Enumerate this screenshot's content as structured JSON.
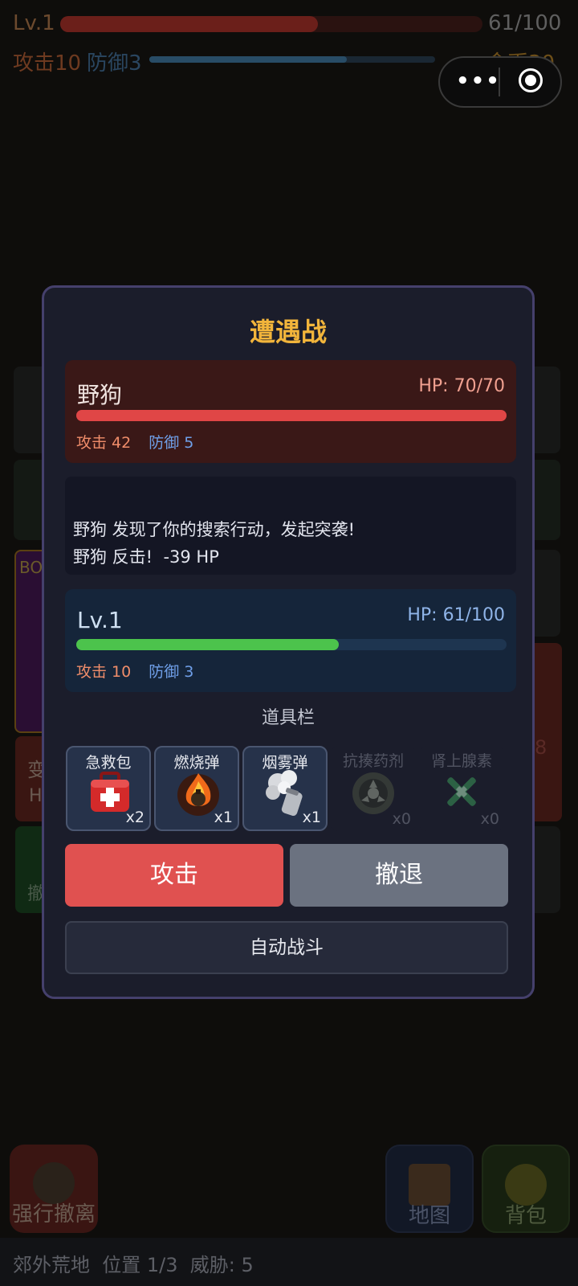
{
  "hud": {
    "level": "Lv.1",
    "hp_text": "61/100",
    "hp_fraction": 0.61,
    "attack": "攻击10",
    "defense": "防御3",
    "coins": "金币30"
  },
  "background": {
    "boss_fragment": "BO",
    "fragment_a": "变",
    "fragment_b": "H",
    "fragment_c": "撤",
    "fragment_d": "8",
    "evacuate_label": "强行撤离",
    "map_label": "地图",
    "bag_label": "背包",
    "status_bar": "郊外荒地  位置 1/3  威胁: 5"
  },
  "battle": {
    "title": "遭遇战",
    "enemy": {
      "name": "野狗",
      "hp_text": "HP: 70/70",
      "hp_fraction": 1.0,
      "attack": "攻击 42",
      "defense": "防御 5"
    },
    "log": [
      "野狗 发现了你的搜索行动，发起突袭!",
      "野狗 反击!  -39 HP"
    ],
    "player": {
      "name": "Lv.1",
      "hp_text": "HP: 61/100",
      "hp_fraction": 0.61,
      "attack": "攻击 10",
      "defense": "防御 3"
    },
    "inventory_title": "道具栏",
    "items": [
      {
        "name": "急救包",
        "count": "x2",
        "icon": "first-aid-kit-icon",
        "enabled": true
      },
      {
        "name": "燃烧弹",
        "count": "x1",
        "icon": "fire-grenade-icon",
        "enabled": true
      },
      {
        "name": "烟雾弹",
        "count": "x1",
        "icon": "smoke-grenade-icon",
        "enabled": true
      },
      {
        "name": "抗揍药剂",
        "count": "x0",
        "icon": "survival-defense-icon",
        "enabled": false
      },
      {
        "name": "肾上腺素",
        "count": "x0",
        "icon": "adrenaline-syringe-icon",
        "enabled": false
      }
    ],
    "attack_label": "攻击",
    "retreat_label": "撤退",
    "auto_label": "自动战斗"
  },
  "colors": {
    "title": "#f2b53b",
    "enemy_bar": "#e04646",
    "player_bar": "#4cc34c",
    "attack_button": "#e05150",
    "retreat_button": "#6b7280"
  }
}
